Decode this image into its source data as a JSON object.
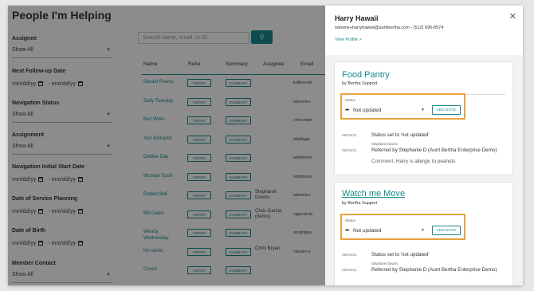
{
  "page": {
    "title": "People I'm Helping"
  },
  "filters": [
    {
      "label": "Assignee",
      "type": "select",
      "value": "Show All"
    },
    {
      "label": "Next Follow-up Date",
      "type": "date",
      "from": "mm/dd/yy",
      "to": "mm/dd/yy"
    },
    {
      "label": "Navigation Status",
      "type": "select",
      "value": "Show All"
    },
    {
      "label": "Assignment",
      "type": "select",
      "value": "Show All"
    },
    {
      "label": "Navigation Initial Start Date",
      "type": "date",
      "from": "mm/dd/yy",
      "to": "mm/dd/yy"
    },
    {
      "label": "Date of Service Planning",
      "type": "date",
      "from": "mm/dd/yy",
      "to": "mm/dd/yy"
    },
    {
      "label": "Date of Birth",
      "type": "date",
      "from": "mm/dd/yy",
      "to": "mm/dd/yy"
    },
    {
      "label": "Member Contact",
      "type": "select",
      "value": "Show All"
    }
  ],
  "search": {
    "placeholder": "Search name, email, or ID",
    "button_icon": "search-icon"
  },
  "table": {
    "headers": [
      "Name",
      "Refer",
      "Summary",
      "Assignee",
      "Email"
    ],
    "refer_label": "REFER",
    "summary_label": "SUMMARY",
    "rows": [
      {
        "name": "Gerald Rivera",
        "assignee": "",
        "email": "kallen+de"
      },
      {
        "name": "Sally Tuesday",
        "assignee": "",
        "email": "sdowns+"
      },
      {
        "name": "Ben Wren",
        "assignee": "",
        "email": "chris+ben"
      },
      {
        "name": "Ann Richards",
        "assignee": "",
        "email": "sbeitage"
      },
      {
        "name": "Debbie Day",
        "assignee": "",
        "email": "smbinson"
      },
      {
        "name": "Michael Scott",
        "assignee": "",
        "email": "smbinson"
      },
      {
        "name": "Robert Bell",
        "assignee": "Stephanie Downs",
        "email": "sdowns+"
      },
      {
        "name": "Bill Gates",
        "assignee": "Chris Garcia (demo)",
        "email": "cgarcia+b"
      },
      {
        "name": "Wendy Wednesday",
        "assignee": "",
        "email": "erodrigue"
      },
      {
        "name": "tim sento",
        "assignee": "Chris Bryan",
        "email": "cbryan+t"
      },
      {
        "name": "Chuck",
        "assignee": "",
        "email": ""
      }
    ]
  },
  "panel": {
    "name": "Harry Hawaii",
    "contact": "sdowns+harryhawaii@auntbertha.com - (512) 696-8574",
    "view_profile": "View Profile >",
    "close_icon": "close-icon",
    "cards": [
      {
        "title": "Food Pantry",
        "by": "by Bertha Support",
        "status_label": "Status",
        "status_value": "Not updated",
        "add_note": "ADD NOTE",
        "activity": [
          {
            "date": "08/25/21",
            "text": "Status set to 'not updated'",
            "by": "Stephanie Downs"
          },
          {
            "date": "08/25/21",
            "text": "Referred by Stephanie D (Aunt Bertha Enterprise Demo)",
            "comment_label": "Comment:",
            "comment": "Harry is allergic to peanuts"
          }
        ]
      },
      {
        "title": "Watch me Move",
        "by": "by Bertha Support",
        "status_label": "Status",
        "status_value": "Not updated",
        "add_note": "ADD NOTE",
        "activity": [
          {
            "date": "08/25/21",
            "text": "Status set to 'not updated'",
            "by": "Stephanie Downs"
          },
          {
            "date": "08/25/21",
            "text": "Referred by Stephanie D (Aunt Bertha Enterprise Demo)"
          }
        ]
      }
    ]
  },
  "colors": {
    "accent": "#1a8a8c",
    "highlight": "#e8a33d"
  }
}
